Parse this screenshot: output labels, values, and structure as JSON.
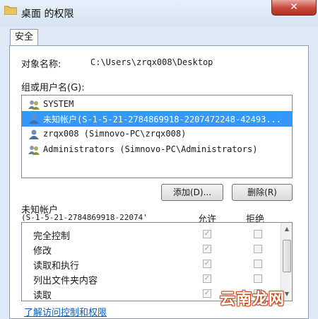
{
  "window": {
    "title": "桌面 的权限",
    "close_glyph": "✕"
  },
  "tabs": [
    {
      "label": "安全",
      "selected": true
    }
  ],
  "object": {
    "label": "对象名称:",
    "path": "C:\\Users\\zrqx008\\Desktop"
  },
  "groups": {
    "label": "组或用户名(G):",
    "items": [
      {
        "name": "SYSTEM",
        "icon": "users-group-icon",
        "selected": false
      },
      {
        "name": "未知帐户(S-1-5-21-2784869918-2207472248-42493...",
        "icon": "user-icon",
        "selected": true
      },
      {
        "name": "zrqx008 (Simnovo-PC\\zrqx008)",
        "icon": "user-icon",
        "selected": false
      },
      {
        "name": "Administrators (Simnovo-PC\\Administrators)",
        "icon": "users-group-icon",
        "selected": false
      }
    ]
  },
  "buttons": {
    "add": "添加(D)...",
    "remove": "删除(R)"
  },
  "permissions": {
    "account_label": "未知帐户",
    "account_sid": "(S-1-5-21-2784869918-22074'",
    "allow_header": "允许",
    "deny_header": "拒绝",
    "rows": [
      {
        "name": "完全控制",
        "allow": true,
        "deny": false
      },
      {
        "name": "修改",
        "allow": true,
        "deny": false
      },
      {
        "name": "读取和执行",
        "allow": true,
        "deny": false
      },
      {
        "name": "列出文件夹内容",
        "allow": true,
        "deny": false
      },
      {
        "name": "读取",
        "allow": true,
        "deny": false
      }
    ]
  },
  "link": "了解访问控制和权限",
  "watermark": "云南龙网",
  "colors": {
    "selection": "#3399ff",
    "link": "#0b5cc7",
    "close": "#c7473a"
  }
}
